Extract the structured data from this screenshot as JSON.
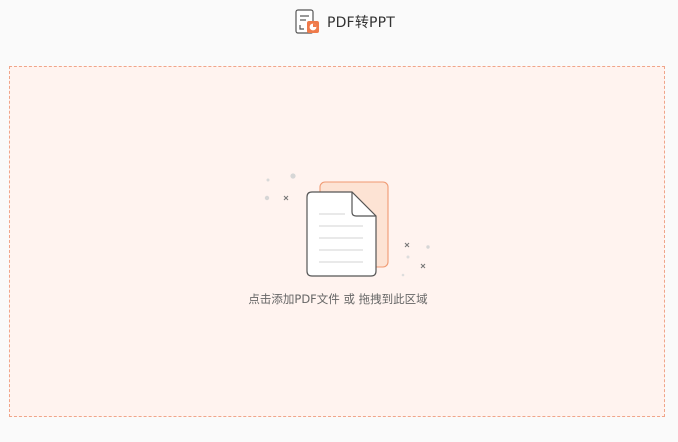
{
  "header": {
    "title": "PDF转PPT",
    "icon": "pdf-to-ppt-icon"
  },
  "drop_zone": {
    "hint_part1": "点击添加PDF文件",
    "hint_separator": " 或 ",
    "hint_part2": "拖拽到此区域",
    "border_color": "#f0a58a",
    "background_color": "#fff3ef",
    "accent_color": "#f4b898"
  }
}
